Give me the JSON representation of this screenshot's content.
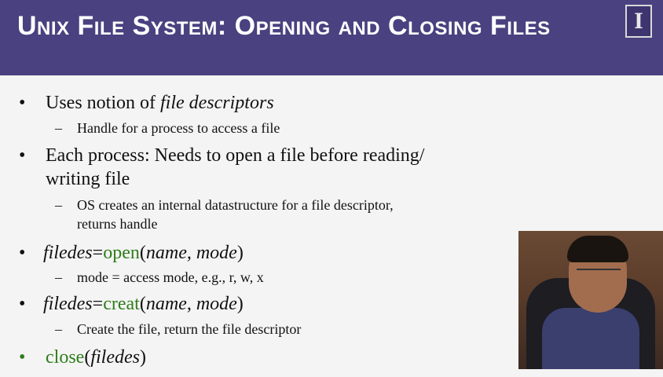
{
  "slide": {
    "title": "Unix File System: Opening and Closing Files",
    "logo_letter": "I",
    "bullet_char": "•",
    "dash_char": "–",
    "b1": {
      "prefix": "Uses notion of ",
      "emph": "file descriptors"
    },
    "b1_sub": "Handle for a process to access a file",
    "b2_line1": "Each process: Needs to open a file before reading/",
    "b2_line2": "writing file",
    "b2_sub_line1": "OS creates an internal datastructure for a file descriptor,",
    "b2_sub_line2": "returns handle",
    "b3": {
      "var": "filedes",
      "eq": "=",
      "func": "open",
      "lp": "(",
      "args": "name, mode",
      "rp": ")"
    },
    "b3_sub": "mode = access mode, e.g., r, w, x",
    "b4": {
      "var": "filedes",
      "eq": "=",
      "func": "creat",
      "lp": "(",
      "args": "name, mode",
      "rp": ")"
    },
    "b4_sub": "Create the file, return the file descriptor",
    "b5": {
      "func": "close",
      "lp": "(",
      "args": "filedes",
      "rp": ")"
    }
  },
  "colors": {
    "header": "#4a4180",
    "code_green": "#2e7d1a",
    "background": "#f4f4f4"
  }
}
